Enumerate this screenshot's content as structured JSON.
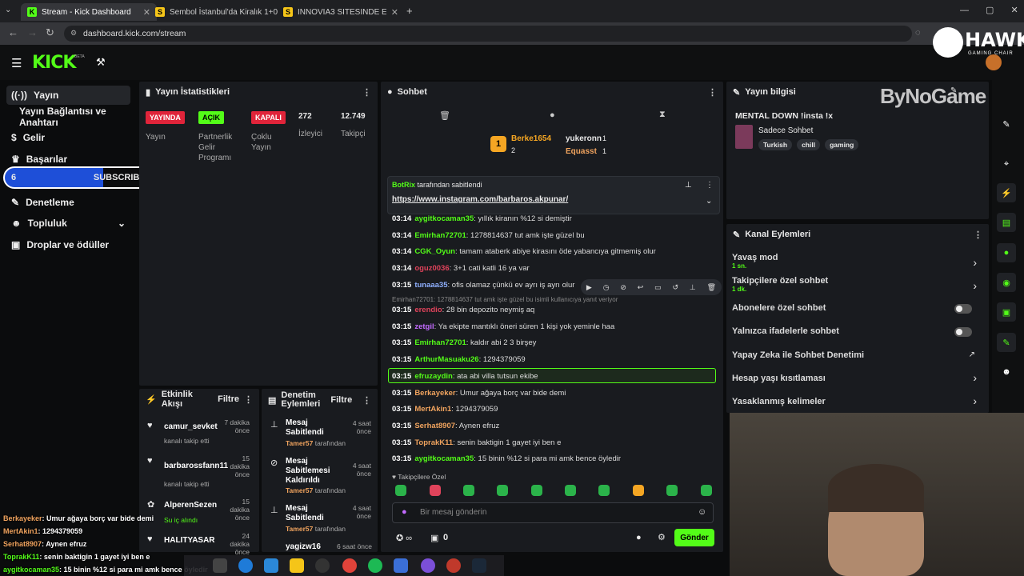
{
  "tabs": [
    {
      "title": "Stream - Kick Dashboard",
      "fav": "K",
      "color": "#53fc18"
    },
    {
      "title": "Sembol İstanbul'da Kiralık 1+0",
      "fav": "S",
      "color": "#f5c518"
    },
    {
      "title": "İNNOVİA3 SİTESİNDE EŞYALI KİRA",
      "fav": "S",
      "color": "#f5c518"
    }
  ],
  "url": "dashboard.kick.com/stream",
  "app": {
    "logo": "KICK",
    "beta": "BETA"
  },
  "sidebar": {
    "items": [
      "Yayın",
      "Yayın Bağlantısı ve Anahtarı",
      "Gelir",
      "Başarılar",
      "Denetleme",
      "Topluluk",
      "Droplar ve ödüller"
    ]
  },
  "subs": {
    "left": "6",
    "label": "SUBSCRIBERS",
    "right": "10"
  },
  "stats": {
    "title": "Yayın İstatistikleri",
    "live_badge": "YAYINDA",
    "live_label": "Yayın",
    "partner_badge": "AÇIK",
    "partner_label": "Partnerlik Gelir Programı",
    "multi_badge": "KAPALI",
    "multi_label": "Çoklu Yayın",
    "viewers": "272",
    "viewers_label": "İzleyici",
    "followers": "12.749",
    "followers_label": "Takipçi"
  },
  "activity": {
    "title": "Etkinlik Akışı",
    "filter": "Filtre",
    "items": [
      {
        "name": "camur_sevket",
        "sub": "kanalı takip etti",
        "time": "7 dakika önce"
      },
      {
        "name": "barbarossfann11",
        "sub": "kanalı takip etti",
        "time": "15 dakika önce"
      },
      {
        "name": "AlperenSezen",
        "sub": "Su iç alındı",
        "time": "15 dakika önce"
      },
      {
        "name": "HALITYASAR",
        "sub": "",
        "time": "24 dakika önce"
      }
    ]
  },
  "modlog": {
    "title": "Denetim Eylemleri",
    "filter": "Filtre",
    "items": [
      {
        "title": "Mesaj Sabitlendi",
        "by": "Tamer57",
        "suffix": "tarafından",
        "time": "4 saat önce"
      },
      {
        "title": "Mesaj Sabitlemesi Kaldırıldı",
        "by": "Tamer57",
        "suffix": "tarafından",
        "time": "4 saat önce"
      },
      {
        "title": "Mesaj Sabitlendi",
        "by": "Tamer57",
        "suffix": "tarafından",
        "time": "4 saat önce"
      },
      {
        "title": "yagizw16",
        "by": "",
        "suffix": "",
        "time": "6 saat önce"
      }
    ]
  },
  "chat": {
    "title": "Sohbet",
    "top": {
      "first": "Berke1654",
      "first_count": "2",
      "second": "yukeronn",
      "second_count": "1",
      "third": "Equasst",
      "third_count": "1"
    },
    "pinned": {
      "by": "BotRix",
      "suffix": "tarafından sabitlendi",
      "link": "https://www.instagram.com/barbaros.akpunar/"
    },
    "reply_ctx": "Emirhan72701: 1278814637 tut amk işte güzel bu isimli kullanıcıya yanıt veriyor",
    "messages": [
      {
        "time": "03:14",
        "user": "aygitkocaman35",
        "color": "#53fc18",
        "text": "yıllık kiranın %12 si demiştir"
      },
      {
        "time": "03:14",
        "user": "Emirhan72701",
        "color": "#53fc18",
        "text": "1278814637 tut amk işte güzel bu"
      },
      {
        "time": "03:14",
        "user": "CGK_Oyun",
        "color": "#53fc18",
        "text": "tamam ataberk abiye kirasını öde yabancıya gitmemiş olur"
      },
      {
        "time": "03:14",
        "user": "oguz0036",
        "color": "#e0435b",
        "text": "3+1 cati katli 16 ya var"
      },
      {
        "time": "03:15",
        "user": "tunaaa35",
        "color": "#8fb0ff",
        "text": "ofis olamaz çünkü ev ayrı iş ayrı olur"
      },
      {
        "time": "03:15",
        "user": "erendio",
        "color": "#e0435b",
        "text": "28 bin depozito neymiş aq"
      },
      {
        "time": "03:15",
        "user": "zetgil",
        "color": "#c36bff",
        "text": "Ya ekipte mantıklı öneri süren 1 kişi yok yeminle haa"
      },
      {
        "time": "03:15",
        "user": "Emirhan72701",
        "color": "#53fc18",
        "text": "kaldır abi 2 3 birşey"
      },
      {
        "time": "03:15",
        "user": "ArthurMasuaku26",
        "color": "#53fc18",
        "text": "1294379059"
      },
      {
        "time": "03:15",
        "user": "efruzaydin",
        "color": "#53fc18",
        "text": "ata abi villa tutsun ekibe"
      },
      {
        "time": "03:15",
        "user": "Berkayeker",
        "color": "#f0a35e",
        "text": "Umur ağaya borç var bide demi"
      },
      {
        "time": "03:15",
        "user": "MertAkin1",
        "color": "#f0a35e",
        "text": "1294379059"
      },
      {
        "time": "03:15",
        "user": "Serhat8907",
        "color": "#f0a35e",
        "text": "Aynen efruz"
      },
      {
        "time": "03:15",
        "user": "ToprakK11",
        "color": "#f0a35e",
        "text": "senin baktigin 1 gayet iyi ben e"
      },
      {
        "time": "03:15",
        "user": "aygitkocaman35",
        "color": "#53fc18",
        "text": "15 binin %12 si para mi amk bence öyledir"
      }
    ],
    "followers_only": "Takipçilere Özel",
    "placeholder": "Bir mesaj gönderin",
    "points": "0",
    "send": "Gönder"
  },
  "info": {
    "title": "Yayın bilgisi",
    "stream_title": "MENTAL DOWN !insta !x",
    "category": "Sadece Sohbet",
    "tags": [
      "Turkish",
      "chill",
      "gaming"
    ]
  },
  "actions": {
    "title": "Kanal Eylemleri",
    "items": [
      {
        "label": "Yavaş mod",
        "sub": "1 sn.",
        "kind": "arrow"
      },
      {
        "label": "Takipçilere özel sohbet",
        "sub": "1 dk.",
        "kind": "arrow"
      },
      {
        "label": "Abonelere özel sohbet",
        "sub": "",
        "kind": "toggle"
      },
      {
        "label": "Yalnızca ifadelerle sohbet",
        "sub": "",
        "kind": "toggle"
      },
      {
        "label": "Yapay Zeka ile Sohbet Denetimi",
        "sub": "",
        "kind": "ext"
      },
      {
        "label": "Hesap yaşı kısıtlaması",
        "sub": "",
        "kind": "arrow"
      },
      {
        "label": "Yasaklanmış kelimeler",
        "sub": "",
        "kind": "arrow"
      }
    ]
  },
  "overlay": {
    "brand": "HAWK",
    "brand_sub": "GAMING CHAIR",
    "sponsor": "ByNoGame",
    "chat": [
      {
        "user": "Berkayeker",
        "text": "Umur ağaya borç var bide demi"
      },
      {
        "user": "MertAkin1",
        "text": "1294379059"
      },
      {
        "user": "Serhat8907",
        "text": "Aynen efruz"
      },
      {
        "user": "ToprakK11",
        "text": "senin baktigin 1 gayet iyi ben e"
      },
      {
        "user": "aygitkocaman35",
        "text": "15 binin %12 si para mi amk bence öyledir"
      }
    ]
  }
}
